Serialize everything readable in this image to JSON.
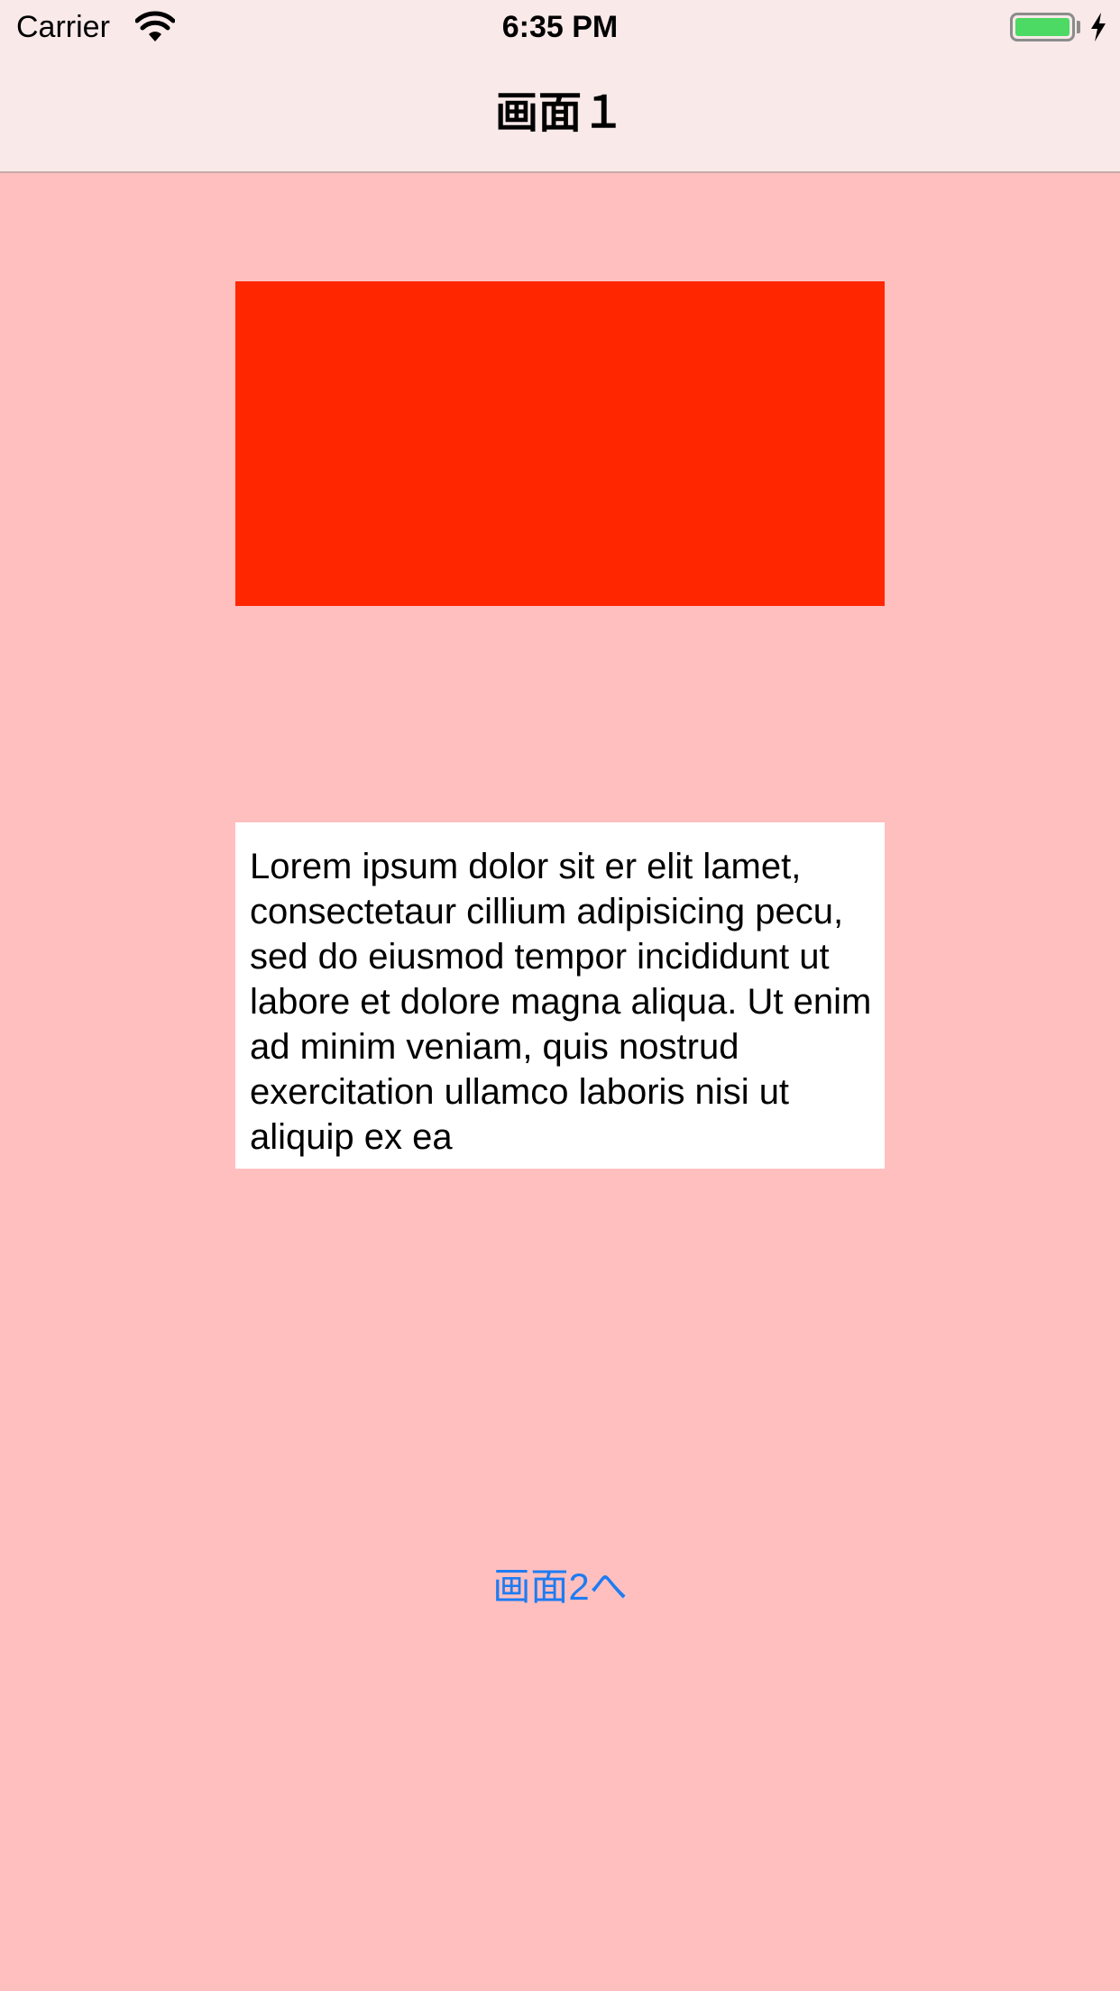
{
  "status_bar": {
    "carrier": "Carrier",
    "time": "6:35 PM",
    "icons": [
      "wifi-icon",
      "battery-icon",
      "charging-icon"
    ],
    "battery_level": 1.0
  },
  "nav_bar": {
    "title": "画面１"
  },
  "main": {
    "red_box_color": "#ff2600",
    "text_view": "Lorem ipsum dolor sit er elit lamet, consectetaur cillium adipisicing pecu, sed do eiusmod tempor incididunt ut labore et dolore magna aliqua. Ut enim ad minim veniam, quis nostrud exercitation ullamco laboris nisi ut aliquip ex ea",
    "next_button_label": "画面2へ"
  },
  "colors": {
    "background": "#ffbfbf",
    "bar_background": "#f9e9e9",
    "link": "#1e7cf2",
    "battery": "#4cd964"
  }
}
